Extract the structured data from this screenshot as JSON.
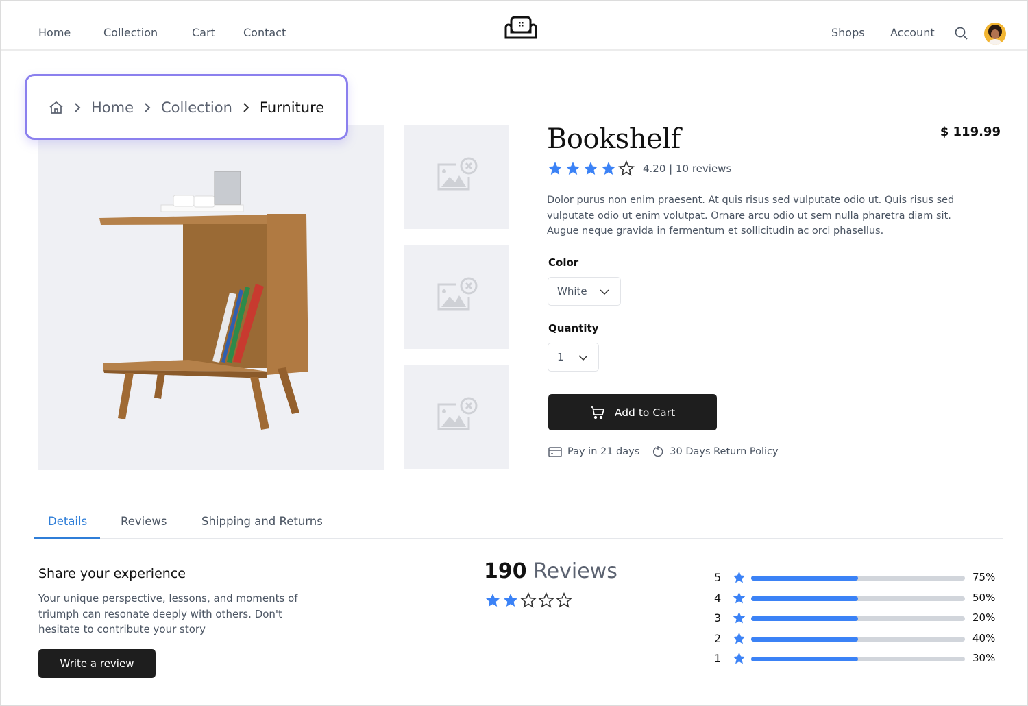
{
  "header": {
    "nav_left": [
      "Home",
      "Collection",
      "Cart",
      "Contact"
    ],
    "nav_right": [
      "Shops",
      "Account"
    ],
    "logo_icon": "sofa-icon",
    "search_icon": "search-icon",
    "avatar_icon": "user-avatar"
  },
  "breadcrumb": {
    "home_icon": "home-icon",
    "items": [
      "Home",
      "Collection",
      "Furniture"
    ]
  },
  "gallery": {
    "main_image": "bookshelf-side-table-photo",
    "thumbnails": [
      "broken-image-icon",
      "broken-image-icon",
      "broken-image-icon"
    ]
  },
  "product": {
    "title": "Bookshelf",
    "price": "$  119.99",
    "rating_value": 4.2,
    "rating_text": "4.20 | 10 reviews",
    "description": "Dolor purus non enim praesent. At quis risus sed vulputate odio ut. Quis risus sed vulputate odio ut enim volutpat. Ornare arcu odio ut sem nulla pharetra diam sit. Augue neque gravida in fermentum et sollicitudin ac orci phasellus.",
    "color_label": "Color",
    "color_value": "White",
    "quantity_label": "Quantity",
    "quantity_value": "1",
    "add_to_cart": "Add to Cart",
    "perks": [
      {
        "icon": "credit-card-icon",
        "text": "Pay in 21 days"
      },
      {
        "icon": "return-icon",
        "text": "30 Days Return Policy"
      }
    ]
  },
  "tabs": {
    "items": [
      "Details",
      "Reviews",
      "Shipping and Returns"
    ],
    "active": "Details"
  },
  "share": {
    "heading": "Share your experience",
    "body": "Your unique perspective, lessons, and moments of triumph can resonate deeply with others. Don't hesitate to contribute your story",
    "button": "Write a review"
  },
  "reviews_summary": {
    "count": "190",
    "count_label": "Reviews",
    "stars_filled": 2,
    "stars_total": 5
  },
  "rating_breakdown": [
    {
      "stars": "5",
      "label": "75%",
      "bar_fill": 0.5
    },
    {
      "stars": "4",
      "label": "50%",
      "bar_fill": 0.5
    },
    {
      "stars": "3",
      "label": "20%",
      "bar_fill": 0.5
    },
    {
      "stars": "2",
      "label": "40%",
      "bar_fill": 0.5
    },
    {
      "stars": "1",
      "label": "30%",
      "bar_fill": 0.5
    }
  ],
  "colors": {
    "accent_blue": "#3b82f6",
    "tab_active": "#2f7ed8",
    "breadcrumb_highlight": "#8b80ee",
    "button_dark": "#1e1e1e"
  }
}
